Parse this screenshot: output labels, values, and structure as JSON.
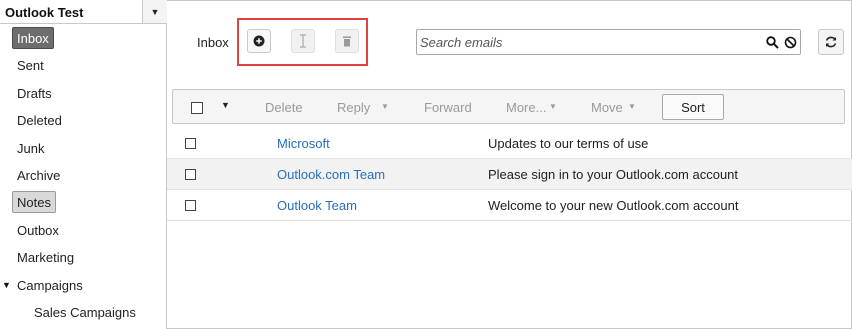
{
  "account": {
    "name": "Outlook Test"
  },
  "sidebar": {
    "folders": [
      {
        "label": "Inbox"
      },
      {
        "label": "Sent"
      },
      {
        "label": "Drafts"
      },
      {
        "label": "Deleted"
      },
      {
        "label": "Junk"
      },
      {
        "label": "Archive"
      },
      {
        "label": "Notes"
      },
      {
        "label": "Outbox"
      },
      {
        "label": "Marketing"
      },
      {
        "label": "Campaigns"
      },
      {
        "label": "Sales Campaigns"
      }
    ]
  },
  "header": {
    "folder_title": "Inbox",
    "toolbar_icons": [
      "add-icon",
      "rename-icon",
      "delete-icon"
    ]
  },
  "search": {
    "placeholder": "Search emails",
    "value": ""
  },
  "commandbar": {
    "delete_label": "Delete",
    "reply_label": "Reply",
    "forward_label": "Forward",
    "more_label": "More...",
    "move_label": "Move",
    "sort_label": "Sort"
  },
  "messages": [
    {
      "sender": "Microsoft",
      "subject": "Updates to our terms of use"
    },
    {
      "sender": "Outlook.com Team",
      "subject": "Please sign in to your Outlook.com account"
    },
    {
      "sender": "Outlook Team",
      "subject": "Welcome to your new Outlook.com account"
    }
  ],
  "colors": {
    "highlight": "#e0443e",
    "link": "#2a6ebb",
    "active_folder": "#6d6d6d"
  }
}
